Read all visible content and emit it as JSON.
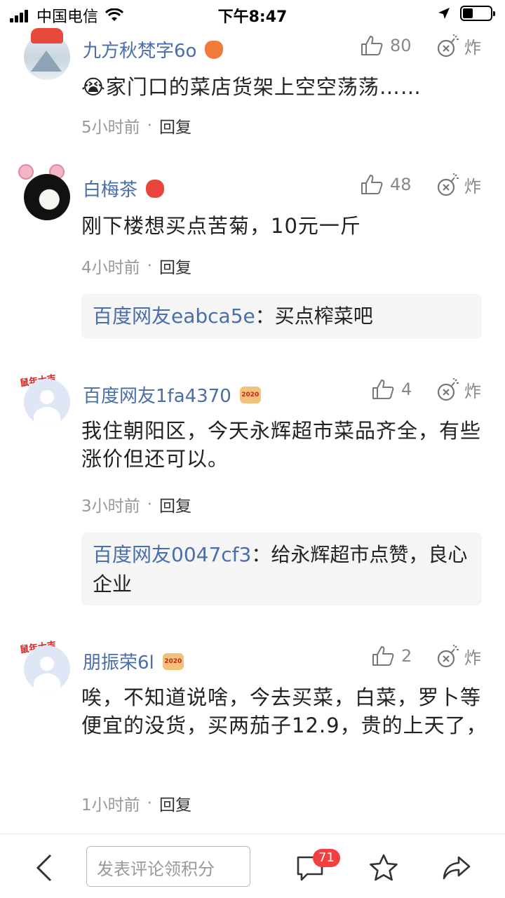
{
  "status": {
    "carrier": "中国电信",
    "time": "下午8:47"
  },
  "comments": [
    {
      "name": "九方秋梵字6o",
      "likes": "80",
      "bomb": "炸",
      "text": "😭家门口的菜店货架上空空荡荡……",
      "time": "5小时前",
      "reply": "回复"
    },
    {
      "name": "白梅茶",
      "likes": "48",
      "bomb": "炸",
      "text": "刚下楼想买点苦菊，10元一斤",
      "time": "4小时前",
      "reply": "回复",
      "sub": {
        "name": "百度网友eabca5e",
        "sep": "：",
        "text": "买点榨菜吧"
      }
    },
    {
      "name": "百度网友1fa4370",
      "likes": "4",
      "bomb": "炸",
      "text": "我住朝阳区，今天永辉超市菜品齐全，有些涨价但还可以。",
      "time": "3小时前",
      "reply": "回复",
      "sub": {
        "name": "百度网友0047cf3",
        "sep": "：",
        "text": "给永辉超市点赞，良心企业"
      },
      "deco": "鼠年大吉",
      "badge": "2020"
    },
    {
      "name": "朋振荣6l",
      "likes": "2",
      "bomb": "炸",
      "text": "唉，不知道说啥，今去买菜，白菜，罗卜等便宜的没货，买两茄子12.9，贵的上天了，",
      "time": "1小时前",
      "reply": "回复",
      "deco": "鼠年大吉",
      "badge": "2020"
    }
  ],
  "meta_dot": "·",
  "bottom": {
    "input_placeholder": "发表评论领积分",
    "comment_count": "71"
  }
}
